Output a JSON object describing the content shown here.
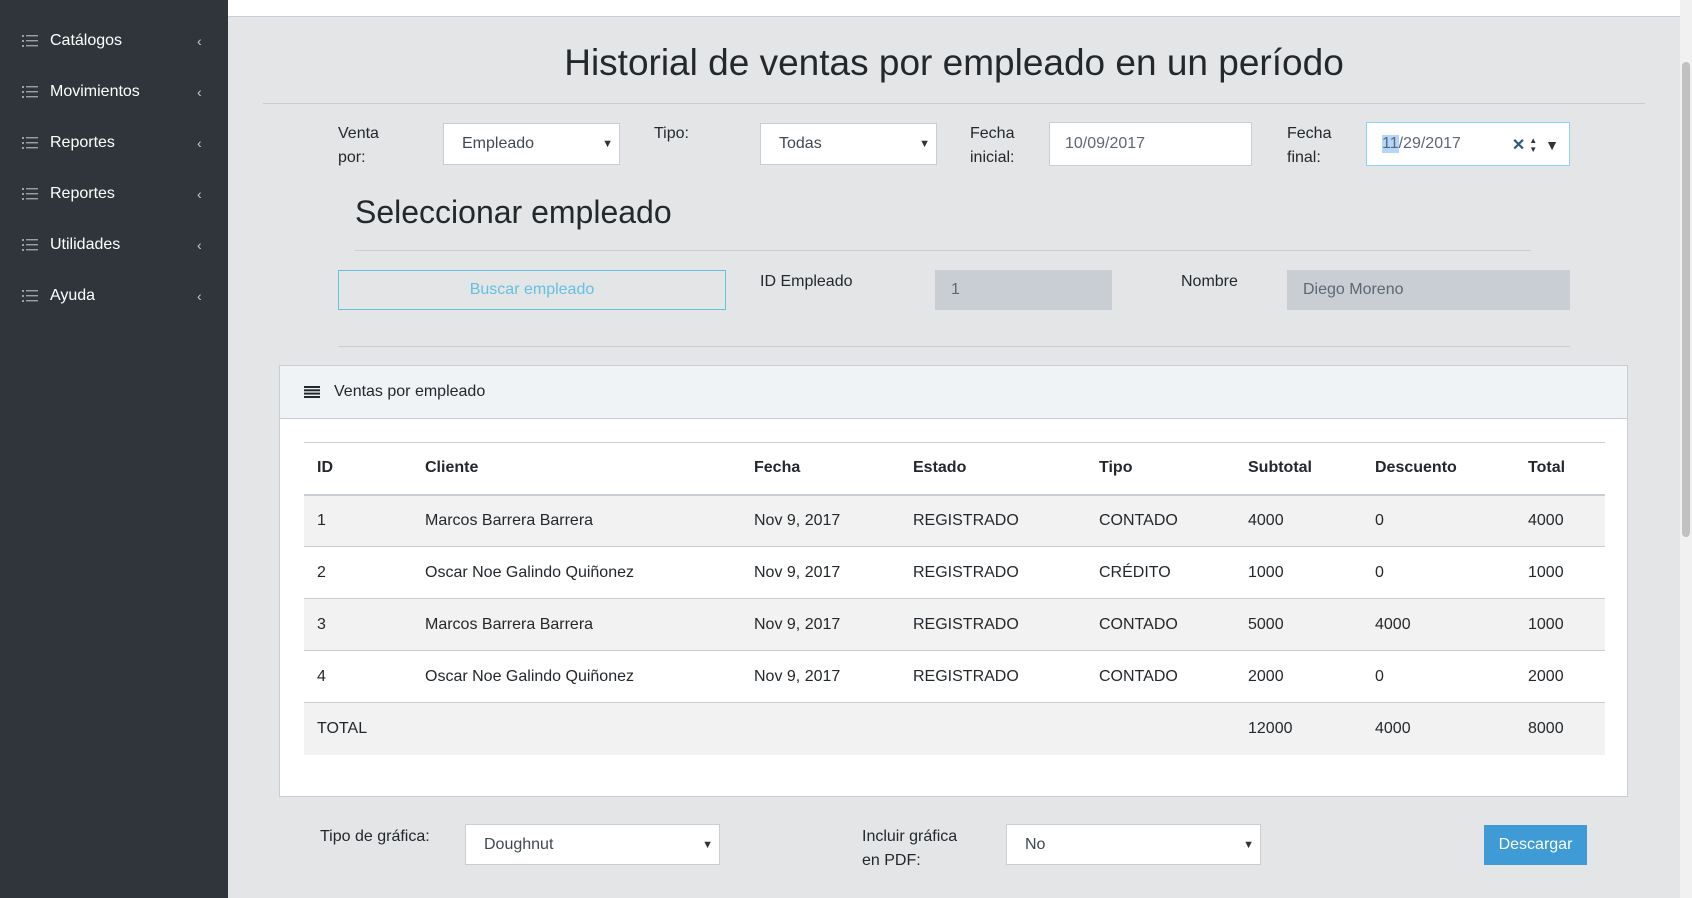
{
  "sidebar": {
    "items": [
      {
        "label": "Catálogos",
        "icon": "list-icon"
      },
      {
        "label": "Movimientos",
        "icon": "list-icon"
      },
      {
        "label": "Reportes",
        "icon": "list-icon"
      },
      {
        "label": "Reportes",
        "icon": "list-icon"
      },
      {
        "label": "Utilidades",
        "icon": "list-icon"
      },
      {
        "label": "Ayuda",
        "icon": "list-icon"
      }
    ],
    "chevron": "‹"
  },
  "page": {
    "title": "Historial de ventas por empleado en un período"
  },
  "filters": {
    "venta_por_label_1": "Venta",
    "venta_por_label_2": "por:",
    "venta_por_value": "Empleado",
    "tipo_label": "Tipo:",
    "tipo_value": "Todas",
    "fecha_inicial_label_1": "Fecha",
    "fecha_inicial_label_2": "inicial:",
    "fecha_inicial_value": "10/09/2017",
    "fecha_final_label_1": "Fecha",
    "fecha_final_label_2": "final:",
    "fecha_final_month": "11",
    "fecha_final_rest": "/29/2017"
  },
  "employee": {
    "section_title": "Seleccionar empleado",
    "search_button": "Buscar empleado",
    "id_label": "ID Empleado",
    "id_value": "1",
    "name_label": "Nombre",
    "name_value": "Diego Moreno"
  },
  "card": {
    "title": "Ventas por empleado",
    "columns": [
      "ID",
      "Cliente",
      "Fecha",
      "Estado",
      "Tipo",
      "Subtotal",
      "Descuento",
      "Total"
    ],
    "rows": [
      [
        "1",
        "Marcos Barrera Barrera",
        "Nov 9, 2017",
        "REGISTRADO",
        "CONTADO",
        "4000",
        "0",
        "4000"
      ],
      [
        "2",
        "Oscar Noe Galindo Quiñonez",
        "Nov 9, 2017",
        "REGISTRADO",
        "CRÉDITO",
        "1000",
        "0",
        "1000"
      ],
      [
        "3",
        "Marcos Barrera Barrera",
        "Nov 9, 2017",
        "REGISTRADO",
        "CONTADO",
        "5000",
        "4000",
        "1000"
      ],
      [
        "4",
        "Oscar Noe Galindo Quiñonez",
        "Nov 9, 2017",
        "REGISTRADO",
        "CONTADO",
        "2000",
        "0",
        "2000"
      ],
      [
        "TOTAL",
        "",
        "",
        "",
        "",
        "12000",
        "4000",
        "8000"
      ]
    ]
  },
  "footer": {
    "chart_type_label": "Tipo de gráfica:",
    "chart_type_value": "Doughnut",
    "include_label_1": "Incluir gráfica",
    "include_label_2": "en PDF:",
    "include_value": "No",
    "download_button": "Descargar"
  },
  "colors": {
    "sidebar_bg": "#2f353a",
    "accent": "#3e9bd6",
    "outline_button": "#63c2de"
  }
}
